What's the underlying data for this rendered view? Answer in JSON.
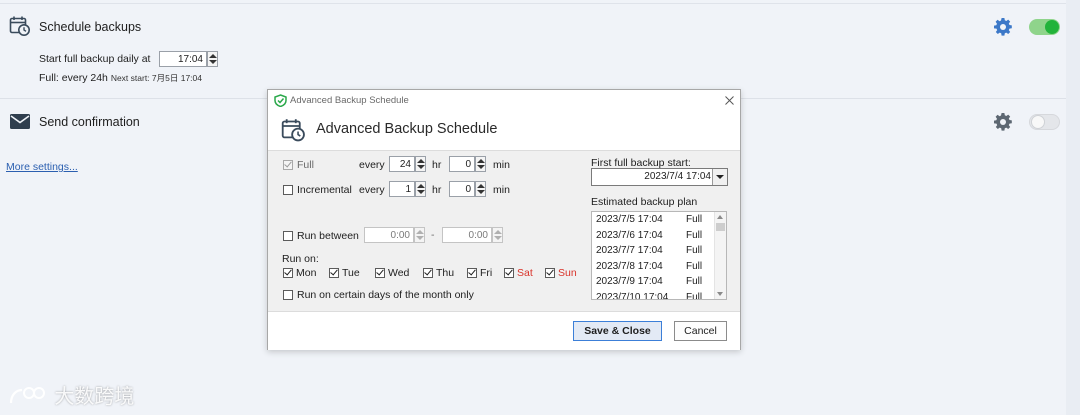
{
  "rows": {
    "schedule": {
      "title": "Schedule backups",
      "full_label": "Start full backup daily at",
      "full_time": "17:04",
      "summary_prefix": "Full:",
      "summary_value": "every 24h",
      "next_start": "Next start: 7月5日 17:04",
      "toggle_state": "on"
    },
    "confirm": {
      "title": "Send confirmation",
      "toggle_state": "off"
    },
    "more_settings": "More settings..."
  },
  "dialog": {
    "window_title": "Advanced Backup Schedule",
    "header_title": "Advanced Backup Schedule",
    "full": {
      "label": "Full",
      "checked": true,
      "every": "every",
      "hr_value": "24",
      "hr_unit": "hr",
      "min_value": "0",
      "min_unit": "min"
    },
    "incremental": {
      "label": "Incremental",
      "checked": false,
      "every": "every",
      "hr_value": "1",
      "hr_unit": "hr",
      "min_value": "0",
      "min_unit": "min"
    },
    "run_between": {
      "label": "Run between",
      "checked": false,
      "from": "0:00",
      "dash": "-",
      "to": "0:00"
    },
    "run_on_label": "Run on:",
    "days": [
      {
        "label": "Mon",
        "checked": true,
        "weekend": false
      },
      {
        "label": "Tue",
        "checked": true,
        "weekend": false
      },
      {
        "label": "Wed",
        "checked": true,
        "weekend": false
      },
      {
        "label": "Thu",
        "checked": true,
        "weekend": false
      },
      {
        "label": "Fri",
        "checked": true,
        "weekend": false
      },
      {
        "label": "Sat",
        "checked": true,
        "weekend": true
      },
      {
        "label": "Sun",
        "checked": true,
        "weekend": true
      }
    ],
    "month_days": {
      "label": "Run on certain days of the month only",
      "checked": false
    },
    "first_start_label": "First full backup start:",
    "first_start_value": "2023/7/4 17:04",
    "plan_label": "Estimated backup plan",
    "plan": [
      {
        "date": "2023/7/5 17:04",
        "type": "Full"
      },
      {
        "date": "2023/7/6 17:04",
        "type": "Full"
      },
      {
        "date": "2023/7/7 17:04",
        "type": "Full"
      },
      {
        "date": "2023/7/8 17:04",
        "type": "Full"
      },
      {
        "date": "2023/7/9 17:04",
        "type": "Full"
      },
      {
        "date": "2023/7/10 17:04",
        "type": "Full"
      }
    ],
    "save_button": "Save & Close",
    "cancel_button": "Cancel"
  },
  "watermark": "大数跨境",
  "colors": {
    "accent_blue": "#3c78c8",
    "toggle_on": "#22b33a",
    "weekend_red": "#d9342b",
    "link": "#2b5fb0"
  }
}
